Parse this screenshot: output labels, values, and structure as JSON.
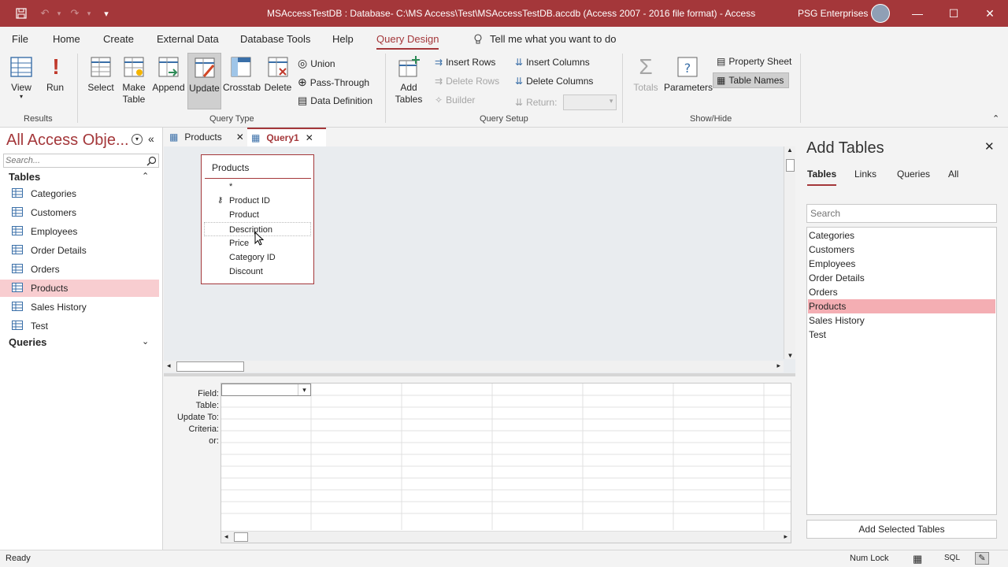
{
  "window": {
    "title": "MSAccessTestDB : Database- C:\\MS Access\\Test\\MSAccessTestDB.accdb (Access 2007 - 2016 file format)  -  Access",
    "user": "PSG Enterprises"
  },
  "ribbon_tabs": [
    {
      "label": "File"
    },
    {
      "label": "Home"
    },
    {
      "label": "Create"
    },
    {
      "label": "External Data"
    },
    {
      "label": "Database Tools"
    },
    {
      "label": "Help"
    },
    {
      "label": "Query Design"
    }
  ],
  "tell_me": "Tell me what you want to do",
  "ribbon": {
    "results": {
      "view": "View",
      "run": "Run",
      "group": "Results"
    },
    "query_type": {
      "select": "Select",
      "make_table_1": "Make",
      "make_table_2": "Table",
      "append": "Append",
      "update": "Update",
      "crosstab": "Crosstab",
      "delete": "Delete",
      "union": "Union",
      "pass_through": "Pass-Through",
      "data_definition": "Data Definition",
      "group": "Query Type"
    },
    "query_setup": {
      "add_tables_1": "Add",
      "add_tables_2": "Tables",
      "insert_rows": "Insert Rows",
      "delete_rows": "Delete Rows",
      "builder": "Builder",
      "insert_columns": "Insert Columns",
      "delete_columns": "Delete Columns",
      "return": "Return:",
      "group": "Query Setup"
    },
    "show_hide": {
      "totals": "Totals",
      "parameters": "Parameters",
      "property_sheet": "Property Sheet",
      "table_names": "Table Names",
      "group": "Show/Hide"
    }
  },
  "nav": {
    "title": "All Access Obje...",
    "search_placeholder": "Search...",
    "tables_header": "Tables",
    "tables": [
      "Categories",
      "Customers",
      "Employees",
      "Order Details",
      "Orders",
      "Products",
      "Sales History",
      "Test"
    ],
    "selected": "Products",
    "queries_header": "Queries"
  },
  "doc_tabs": [
    {
      "label": "Products"
    },
    {
      "label": "Query1"
    }
  ],
  "field_list": {
    "title": "Products",
    "fields": [
      "*",
      "Product ID",
      "Product",
      "Description",
      "Price",
      "Category ID",
      "Discount"
    ]
  },
  "design_grid": {
    "row_labels": [
      "Field:",
      "Table:",
      "Update To:",
      "Criteria:",
      "or:"
    ]
  },
  "add_tables_pane": {
    "title": "Add Tables",
    "tabs": [
      "Tables",
      "Links",
      "Queries",
      "All"
    ],
    "search_placeholder": "Search",
    "items": [
      "Categories",
      "Customers",
      "Employees",
      "Order Details",
      "Orders",
      "Products",
      "Sales History",
      "Test"
    ],
    "selected": "Products",
    "add_button": "Add Selected Tables"
  },
  "status": {
    "left": "Ready",
    "num_lock": "Num Lock",
    "sql": "SQL"
  },
  "colors": {
    "accent": "#a4373a",
    "selection": "#f8cdd0"
  }
}
